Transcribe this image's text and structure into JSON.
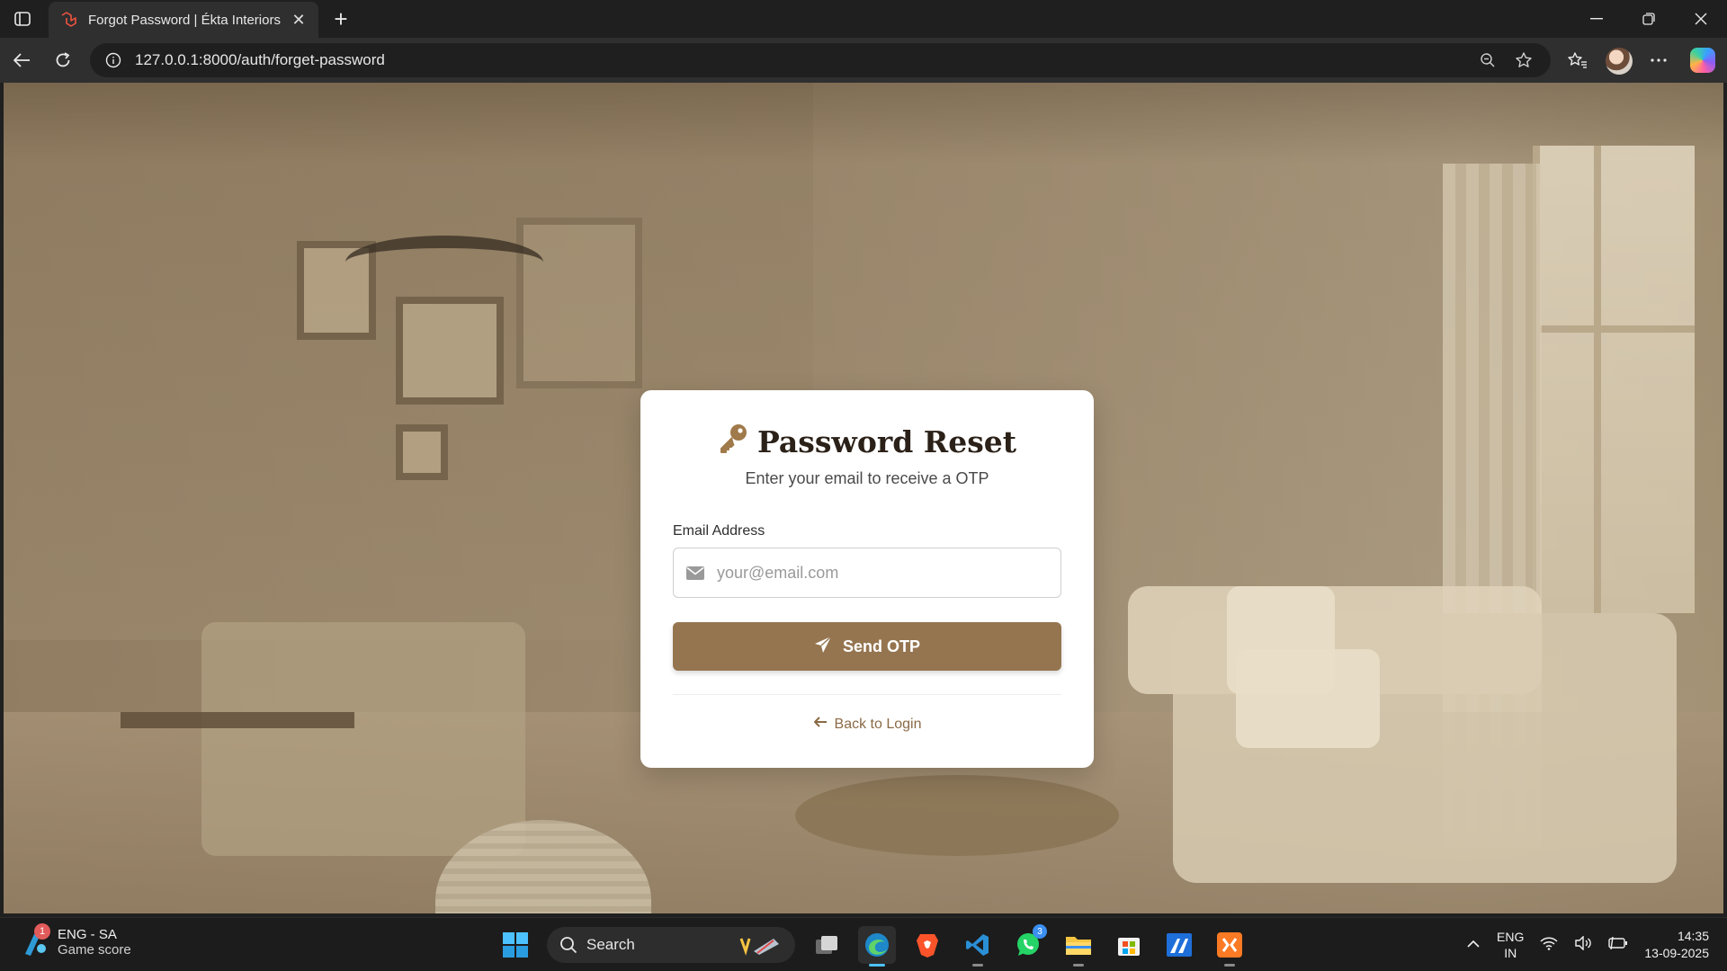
{
  "browser": {
    "tab_title": "Forgot Password | Ékta Interiors",
    "url": "127.0.0.1:8000/auth/forget-password"
  },
  "card": {
    "title": "Password Reset",
    "subtitle": "Enter your email to receive a OTP",
    "email_label": "Email Address",
    "email_placeholder": "your@email.com",
    "send_button": "Send OTP",
    "back_link": "Back to Login"
  },
  "taskbar": {
    "weather_badge": "1",
    "weather_line1": "ENG - SA",
    "weather_line2": "Game score",
    "search_label": "Search",
    "whatsapp_badge": "3",
    "lang_top": "ENG",
    "lang_bottom": "IN",
    "time": "14:35",
    "date": "13-09-2025"
  },
  "icons": [
    "sidebar-toggle-icon",
    "laravel-favicon-icon",
    "close-tab-icon",
    "new-tab-icon",
    "minimize-icon",
    "maximize-icon",
    "window-close-icon",
    "back-icon",
    "refresh-icon",
    "site-info-icon",
    "zoom-icon",
    "favorite-star-icon",
    "favorites-icon",
    "more-icon",
    "key-icon",
    "envelope-icon",
    "paper-plane-icon",
    "arrow-left-icon"
  ],
  "colors": {
    "accent": "#957550",
    "link": "#8a6a45",
    "title": "#2b2118"
  }
}
